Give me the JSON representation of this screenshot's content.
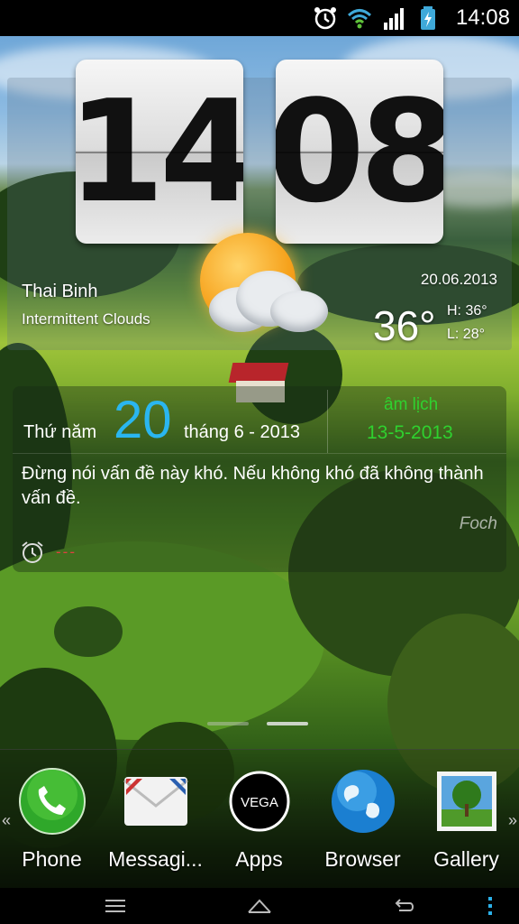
{
  "status_bar": {
    "time": "14:08",
    "icons": [
      "alarm-clock-icon",
      "wifi-icon",
      "signal-icon",
      "battery-icon"
    ]
  },
  "clock_widget": {
    "hours": "14",
    "minutes": "08",
    "weather_icon": "sun-with-clouds-icon",
    "city": "Thai Binh",
    "condition": "Intermittent Clouds",
    "date": "20.06.2013",
    "temperature": "36°",
    "high": "H:  36°",
    "low": "L:  28°"
  },
  "calendar_widget": {
    "weekday": "Thứ năm",
    "day": "20",
    "month_year": "tháng 6 - 2013",
    "lunar_label": "âm lịch",
    "lunar_date": "13-5-2013",
    "quote": "Đừng nói vấn đề này khó. Nếu không khó đã không thành vấn đề.",
    "author": "Foch",
    "alarm_text": "---"
  },
  "home_pages": {
    "count": 2,
    "current": 2
  },
  "dock": {
    "items": [
      {
        "label": "Phone",
        "icon": "phone-icon"
      },
      {
        "label": "Messagi...",
        "icon": "envelope-icon"
      },
      {
        "label": "Apps",
        "icon": "vega-apps-icon"
      },
      {
        "label": "Browser",
        "icon": "globe-icon"
      },
      {
        "label": "Gallery",
        "icon": "picture-icon"
      }
    ]
  },
  "navbar": {
    "icons": [
      "menu-icon",
      "home-icon",
      "back-icon",
      "overflow-icon"
    ]
  },
  "colors": {
    "calendar_day": "#2ab6f0",
    "lunar": "#2fd12f",
    "alarm_placeholder": "#e04040"
  }
}
